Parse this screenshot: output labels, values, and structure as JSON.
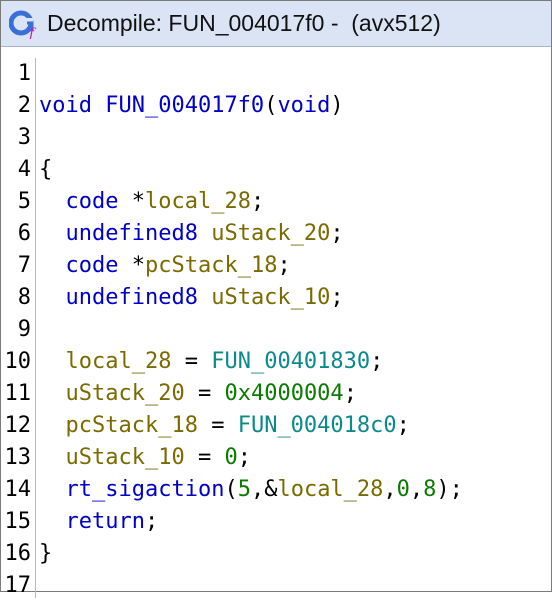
{
  "window": {
    "title": "Decompile: FUN_004017f0 -  (avx512)",
    "icon": "decompiler-icon"
  },
  "colors": {
    "keyword": "#0000c8",
    "variable": "#7a6a00",
    "function": "#0b8a8a",
    "number": "#0a7a00",
    "titlebar": "#dbe4f4"
  },
  "lines": [
    {
      "n": "1",
      "tokens": []
    },
    {
      "n": "2",
      "tokens": [
        {
          "t": "void",
          "c": "kw"
        },
        {
          "t": " ",
          "c": "plain"
        },
        {
          "t": "FUN_004017f0",
          "c": "kw"
        },
        {
          "t": "(",
          "c": "plain"
        },
        {
          "t": "void",
          "c": "kw"
        },
        {
          "t": ")",
          "c": "plain"
        }
      ]
    },
    {
      "n": "3",
      "tokens": []
    },
    {
      "n": "4",
      "tokens": [
        {
          "t": "{",
          "c": "plain"
        }
      ]
    },
    {
      "n": "5",
      "tokens": [
        {
          "t": "  ",
          "c": "plain"
        },
        {
          "t": "code",
          "c": "kw"
        },
        {
          "t": " *",
          "c": "plain"
        },
        {
          "t": "local_28",
          "c": "var"
        },
        {
          "t": ";",
          "c": "plain"
        }
      ]
    },
    {
      "n": "6",
      "tokens": [
        {
          "t": "  ",
          "c": "plain"
        },
        {
          "t": "undefined8",
          "c": "kw"
        },
        {
          "t": " ",
          "c": "plain"
        },
        {
          "t": "uStack_20",
          "c": "var"
        },
        {
          "t": ";",
          "c": "plain"
        }
      ]
    },
    {
      "n": "7",
      "tokens": [
        {
          "t": "  ",
          "c": "plain"
        },
        {
          "t": "code",
          "c": "kw"
        },
        {
          "t": " *",
          "c": "plain"
        },
        {
          "t": "pcStack_18",
          "c": "var"
        },
        {
          "t": ";",
          "c": "plain"
        }
      ]
    },
    {
      "n": "8",
      "tokens": [
        {
          "t": "  ",
          "c": "plain"
        },
        {
          "t": "undefined8",
          "c": "kw"
        },
        {
          "t": " ",
          "c": "plain"
        },
        {
          "t": "uStack_10",
          "c": "var"
        },
        {
          "t": ";",
          "c": "plain"
        }
      ]
    },
    {
      "n": "9",
      "tokens": []
    },
    {
      "n": "10",
      "tokens": [
        {
          "t": "  ",
          "c": "plain"
        },
        {
          "t": "local_28",
          "c": "var"
        },
        {
          "t": " = ",
          "c": "plain"
        },
        {
          "t": "FUN_00401830",
          "c": "fn"
        },
        {
          "t": ";",
          "c": "plain"
        }
      ]
    },
    {
      "n": "11",
      "tokens": [
        {
          "t": "  ",
          "c": "plain"
        },
        {
          "t": "uStack_20",
          "c": "var"
        },
        {
          "t": " = ",
          "c": "plain"
        },
        {
          "t": "0x4000004",
          "c": "num"
        },
        {
          "t": ";",
          "c": "plain"
        }
      ]
    },
    {
      "n": "12",
      "tokens": [
        {
          "t": "  ",
          "c": "plain"
        },
        {
          "t": "pcStack_18",
          "c": "var"
        },
        {
          "t": " = ",
          "c": "plain"
        },
        {
          "t": "FUN_004018c0",
          "c": "fn"
        },
        {
          "t": ";",
          "c": "plain"
        }
      ]
    },
    {
      "n": "13",
      "tokens": [
        {
          "t": "  ",
          "c": "plain"
        },
        {
          "t": "uStack_10",
          "c": "var"
        },
        {
          "t": " = ",
          "c": "plain"
        },
        {
          "t": "0",
          "c": "num"
        },
        {
          "t": ";",
          "c": "plain"
        }
      ]
    },
    {
      "n": "14",
      "tokens": [
        {
          "t": "  ",
          "c": "plain"
        },
        {
          "t": "rt_sigaction",
          "c": "kw"
        },
        {
          "t": "(",
          "c": "plain"
        },
        {
          "t": "5",
          "c": "num"
        },
        {
          "t": ",&",
          "c": "plain"
        },
        {
          "t": "local_28",
          "c": "var"
        },
        {
          "t": ",",
          "c": "plain"
        },
        {
          "t": "0",
          "c": "num"
        },
        {
          "t": ",",
          "c": "plain"
        },
        {
          "t": "8",
          "c": "num"
        },
        {
          "t": ");",
          "c": "plain"
        }
      ]
    },
    {
      "n": "15",
      "tokens": [
        {
          "t": "  ",
          "c": "plain"
        },
        {
          "t": "return",
          "c": "kw"
        },
        {
          "t": ";",
          "c": "plain"
        }
      ]
    },
    {
      "n": "16",
      "tokens": [
        {
          "t": "}",
          "c": "plain"
        }
      ]
    },
    {
      "n": "17",
      "tokens": []
    }
  ]
}
